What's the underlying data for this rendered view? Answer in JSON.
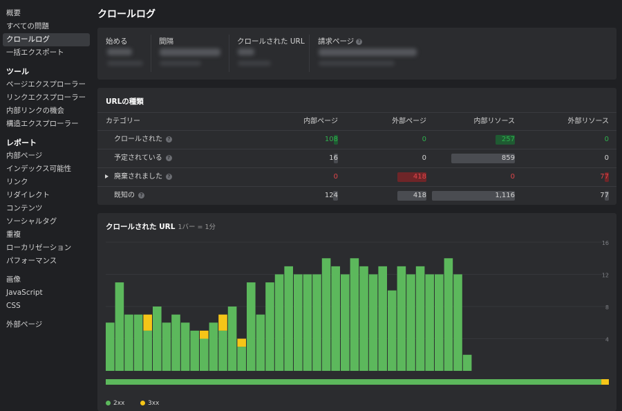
{
  "sidebar": {
    "top_items": [
      "概要",
      "すべての問題",
      "クロールログ",
      "一括エクスポート"
    ],
    "active_item": "クロールログ",
    "tools_heading": "ツール",
    "tools_items": [
      "ページエクスプローラー",
      "リンクエクスプローラー",
      "内部リンクの機会",
      "構造エクスプローラー"
    ],
    "reports_heading": "レポート",
    "reports_items": [
      "内部ページ",
      "インデックス可能性",
      "リンク",
      "リダイレクト",
      "コンテンツ",
      "ソーシャルタグ",
      "重複",
      "ローカリゼーション",
      "パフォーマンス"
    ],
    "media_items": [
      "画像",
      "JavaScript",
      "CSS"
    ],
    "external_items": [
      "外部ページ"
    ]
  },
  "page": {
    "title": "クロールログ"
  },
  "stats": {
    "started_label": "始める",
    "interval_label": "間隔",
    "crawled_label": "クロールされた URL",
    "requests_label": "請求ページ"
  },
  "url_types": {
    "title": "URLの種類",
    "columns": [
      "カテゴリー",
      "内部ページ",
      "外部ページ",
      "内部リソース",
      "外部リソース"
    ],
    "rows": [
      {
        "label": "クロールされた",
        "help": true,
        "expand": false,
        "tone": "green",
        "values": [
          "108",
          "0",
          "257",
          "0"
        ],
        "bars": [
          0.05,
          0,
          0.23,
          0
        ]
      },
      {
        "label": "予定されている",
        "help": true,
        "expand": false,
        "tone": "gray",
        "values": [
          "16",
          "0",
          "859",
          "0"
        ],
        "bars": [
          0.01,
          0,
          0.77,
          0
        ]
      },
      {
        "label": "廃棄されました",
        "help": true,
        "expand": true,
        "tone": "red",
        "values": [
          "0",
          "418",
          "0",
          "77"
        ],
        "bars": [
          0,
          0.35,
          0,
          0.03
        ]
      },
      {
        "label": "既知の",
        "help": true,
        "expand": false,
        "tone": "gray",
        "values": [
          "124",
          "418",
          "1,116",
          "77"
        ],
        "bars": [
          0.06,
          0.35,
          1.0,
          0.03
        ]
      }
    ]
  },
  "chart": {
    "title": "クロールされた URL",
    "subtitle": "1バー = 1分",
    "legend": [
      {
        "label": "2xx",
        "color": "#5cb85c"
      },
      {
        "label": "3xx",
        "color": "#f5c518"
      }
    ]
  },
  "chart_data": {
    "type": "bar",
    "stacked": true,
    "title": "クロールされた URL",
    "subtitle": "1バー = 1分",
    "ylim": [
      0,
      16
    ],
    "yticks": [
      4,
      8,
      12,
      16
    ],
    "series": [
      {
        "name": "2xx",
        "color": "#5cb85c",
        "values": [
          6,
          11,
          7,
          7,
          5,
          8,
          6,
          7,
          6,
          5,
          4,
          6,
          5,
          8,
          3,
          11,
          7,
          11,
          12,
          13,
          12,
          12,
          12,
          14,
          13,
          12,
          14,
          13,
          12,
          13,
          10,
          13,
          12,
          13,
          12,
          12,
          14,
          12,
          2
        ]
      },
      {
        "name": "3xx",
        "color": "#f5c518",
        "values": [
          0,
          0,
          0,
          0,
          2,
          0,
          0,
          0,
          0,
          0,
          1,
          0,
          2,
          0,
          1,
          0,
          0,
          0,
          0,
          0,
          0,
          0,
          0,
          0,
          0,
          0,
          0,
          0,
          0,
          0,
          0,
          0,
          0,
          0,
          0,
          0,
          0,
          0,
          0
        ]
      }
    ],
    "progress_fraction_2xx": 0.985
  }
}
